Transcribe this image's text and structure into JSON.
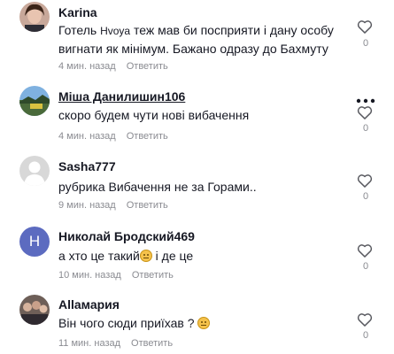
{
  "comments": [
    {
      "name": "Karina",
      "text_before": "Готель ",
      "text_hvoya": "Hvoya",
      "text_after": " теж мав би посприяти і дану особу",
      "text_line2": "вигнати як мінімум. Бажано одразу до Бахмуту",
      "time": "4 мин. назад",
      "reply": "Ответить",
      "likes": "0",
      "avatar": "photo-woman"
    },
    {
      "name": "Міша Данилишин106",
      "text": "скоро будем чути нові вибачення",
      "time": "4 мин. назад",
      "reply": "Ответить",
      "likes": "0",
      "avatar": "photo-landscape"
    },
    {
      "name": "Sasha777",
      "text": "рубрика Вибачення не за Горами..",
      "time": "9 мин. назад",
      "reply": "Ответить",
      "likes": "0",
      "avatar": "default-avatar"
    },
    {
      "name": "Николай Бродский469",
      "text": "а хто це такий",
      "text_after": " і де це",
      "time": "10 мин. назад",
      "reply": "Ответить",
      "likes": "0",
      "avatar_letter": "H",
      "avatar_color": "#5c6bc0"
    },
    {
      "name": "Allaмария",
      "text": "Він чого сюди приїхав ? ",
      "time": "11 мин. назад",
      "reply": "Ответить",
      "likes": "0",
      "avatar": "photo-group"
    }
  ]
}
